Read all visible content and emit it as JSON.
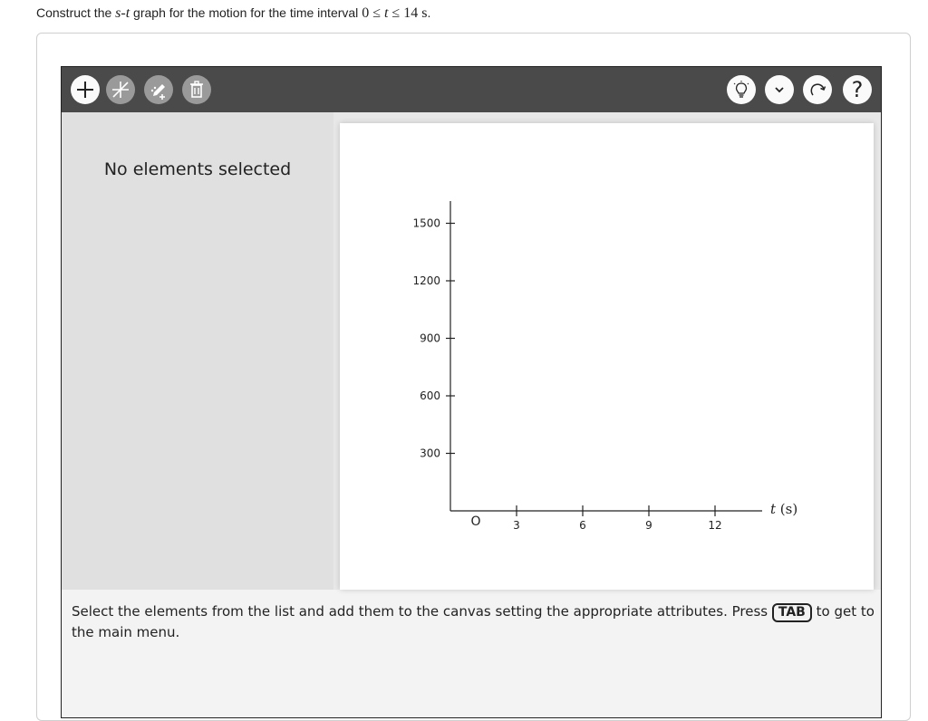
{
  "question": {
    "prefix": "Construct the ",
    "var_s": "s",
    "dash": "-",
    "var_t": "t",
    "middle": " graph for the motion for the time interval ",
    "interval_start": "0 ≤ ",
    "interval_var": "t",
    "interval_end": " ≤ 14 s",
    "suffix": "."
  },
  "toolbar": {
    "left_buttons": [
      {
        "name": "add-icon",
        "state": "enabled"
      },
      {
        "name": "line-icon",
        "state": "disabled"
      },
      {
        "name": "edit-pen-icon",
        "state": "disabled"
      },
      {
        "name": "trash-icon",
        "state": "disabled"
      }
    ],
    "right_buttons": [
      {
        "name": "lightbulb-icon"
      },
      {
        "name": "chevron-down-icon"
      },
      {
        "name": "redo-icon"
      },
      {
        "name": "help-icon",
        "label": "?"
      }
    ]
  },
  "side_panel": {
    "empty_message": "No elements selected"
  },
  "graph": {
    "y_ticks": [
      {
        "value": 300,
        "label": "300"
      },
      {
        "value": 600,
        "label": "600"
      },
      {
        "value": 900,
        "label": "900"
      },
      {
        "value": 1200,
        "label": "1200"
      },
      {
        "value": 1500,
        "label": "1500"
      }
    ],
    "x_ticks": [
      {
        "value": 3,
        "label": "3"
      },
      {
        "value": 6,
        "label": "6"
      },
      {
        "value": 9,
        "label": "9"
      },
      {
        "value": 12,
        "label": "12"
      }
    ],
    "origin_label": "O",
    "x_axis_label_var": "t",
    "x_axis_label_unit": " (s)",
    "x_range": [
      0,
      14
    ],
    "y_range": [
      0,
      1600
    ]
  },
  "instructions": {
    "text_before": "Select the elements from the list and add them to the canvas setting the appropriate attributes. Press ",
    "key": "TAB",
    "text_after": " to get to the main menu."
  }
}
